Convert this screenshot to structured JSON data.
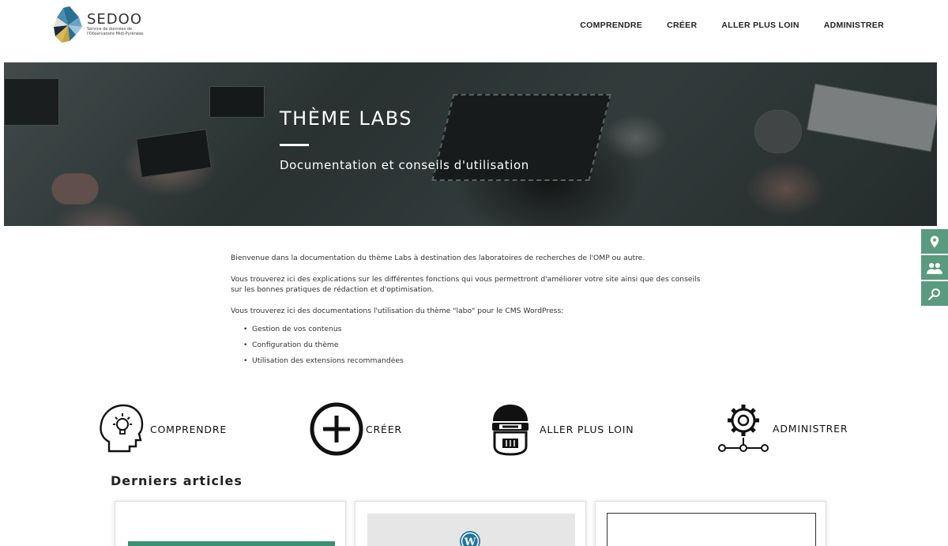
{
  "logo": {
    "title": "SEDOO",
    "subtitle": "Service de données de l'Observatoire Midi-Pyrénées"
  },
  "nav": [
    {
      "label": "COMPRENDRE"
    },
    {
      "label": "CRÉER"
    },
    {
      "label": "ALLER PLUS LOIN"
    },
    {
      "label": "ADMINISTRER"
    }
  ],
  "hero": {
    "title": "THÈME LABS",
    "subtitle": "Documentation et conseils d'utilisation"
  },
  "intro": {
    "p1": "Bienvenue dans la documentation du thème Labs à destination des laboratoires de recherches de l'OMP ou autre.",
    "p2": "Vous trouverez ici des explications sur les différentes fonctions qui vous permettront d'améliorer votre site ainsi que des conseils sur les bonnes pratiques de rédaction et d'optimisation.",
    "p3": "Vous trouverez ici des documentations l'utilisation du thème \"labo\" pour le CMS WordPress:",
    "items": [
      "Gestion de vos contenus",
      "Configuration du thème",
      "Utilisation des extensions recommandées"
    ]
  },
  "features": [
    {
      "label": "COMPRENDRE",
      "icon": "head-lightbulb-icon"
    },
    {
      "label": "CRÉER",
      "icon": "plus-circle-icon"
    },
    {
      "label": "ALLER PLUS LOIN",
      "icon": "robot-icon"
    },
    {
      "label": "ADMINISTRER",
      "icon": "gear-network-icon"
    }
  ],
  "latest": {
    "title": "Derniers articles"
  },
  "colors": {
    "accent": "#5a9a7e"
  }
}
